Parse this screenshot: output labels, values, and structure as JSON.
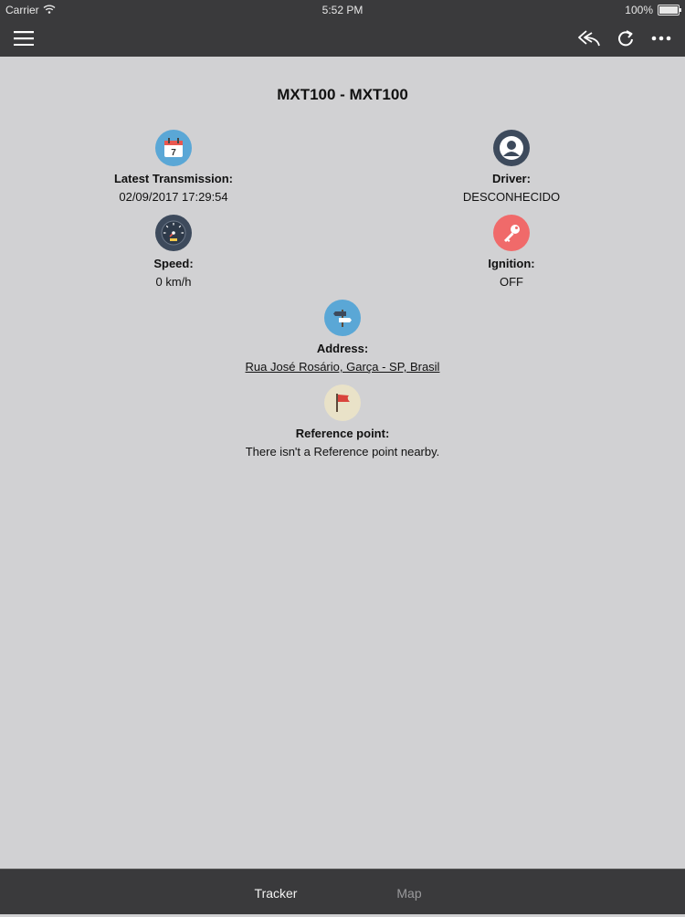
{
  "status_bar": {
    "carrier": "Carrier",
    "time": "5:52 PM",
    "battery": "100%"
  },
  "navbar": {
    "left_icon": "hamburger-menu-icon",
    "right_icons": [
      "reply-icon",
      "refresh-icon",
      "more-icon"
    ]
  },
  "vehicle": {
    "title": "MXT100 - MXT100",
    "latest_transmission": {
      "label": "Latest Transmission:",
      "value": "02/09/2017 17:29:54",
      "icon": "calendar-icon"
    },
    "driver": {
      "label": "Driver:",
      "value": "DESCONHECIDO",
      "icon": "user-icon"
    },
    "speed": {
      "label": "Speed:",
      "value": "0 km/h",
      "icon": "speedometer-icon"
    },
    "ignition": {
      "label": "Ignition:",
      "value": "OFF",
      "icon": "key-icon"
    },
    "address": {
      "label": "Address:",
      "value": "Rua José Rosário, Garça - SP, Brasil",
      "icon": "signpost-icon"
    },
    "reference_point": {
      "label": "Reference point:",
      "value": "There isn't a Reference point nearby.",
      "icon": "flag-icon"
    }
  },
  "tabs": [
    {
      "label": "Tracker",
      "active": true
    },
    {
      "label": "Map",
      "active": false
    }
  ],
  "colors": {
    "bar_background": "#3a3a3c",
    "content_background": "#d1d1d3",
    "calendar": "#5aa7d6",
    "user": "#3d4a5c",
    "speedometer": "#3d4a5c",
    "key": "#f06a6a",
    "signpost": "#5aa7d6",
    "flag": "#e9e2c8"
  }
}
